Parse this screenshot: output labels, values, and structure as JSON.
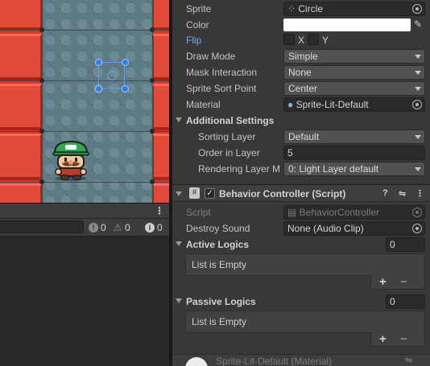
{
  "console": {
    "error_count": "0",
    "warning_count": "0",
    "info_count": "0"
  },
  "sprite_renderer": {
    "sprite_label": "Sprite",
    "sprite_value": "Circle",
    "color_label": "Color",
    "color_value": "#ffffff",
    "flip_label": "Flip",
    "flip_x_label": "X",
    "flip_y_label": "Y",
    "draw_mode_label": "Draw Mode",
    "draw_mode_value": "Simple",
    "mask_label": "Mask Interaction",
    "mask_value": "None",
    "sort_point_label": "Sprite Sort Point",
    "sort_point_value": "Center",
    "material_label": "Material",
    "material_value": "Sprite-Lit-Default",
    "additional_label": "Additional Settings",
    "sorting_layer_label": "Sorting Layer",
    "sorting_layer_value": "Default",
    "order_label": "Order in Layer",
    "order_value": "5",
    "rendering_layer_label": "Rendering Layer M",
    "rendering_layer_value": "0: Light Layer default"
  },
  "behavior": {
    "title": "Behavior Controller (Script)",
    "script_label": "Script",
    "script_value": "BehaviorController",
    "destroy_sound_label": "Destroy Sound",
    "destroy_sound_value": "None (Audio Clip)",
    "active_label": "Active Logics",
    "active_count": "0",
    "active_empty": "List is Empty",
    "passive_label": "Passive Logics",
    "passive_count": "0",
    "passive_empty": "List is Empty"
  },
  "material_footer": {
    "name": "Sprite-Lit-Default (Material)"
  },
  "icons": {
    "help": "?",
    "settings": "⇋",
    "more": "⋮",
    "plus": "+",
    "minus": "−",
    "hash": "#",
    "check": "✓",
    "picker": "✎",
    "error": "!",
    "warn": "⚠",
    "info": "i"
  }
}
